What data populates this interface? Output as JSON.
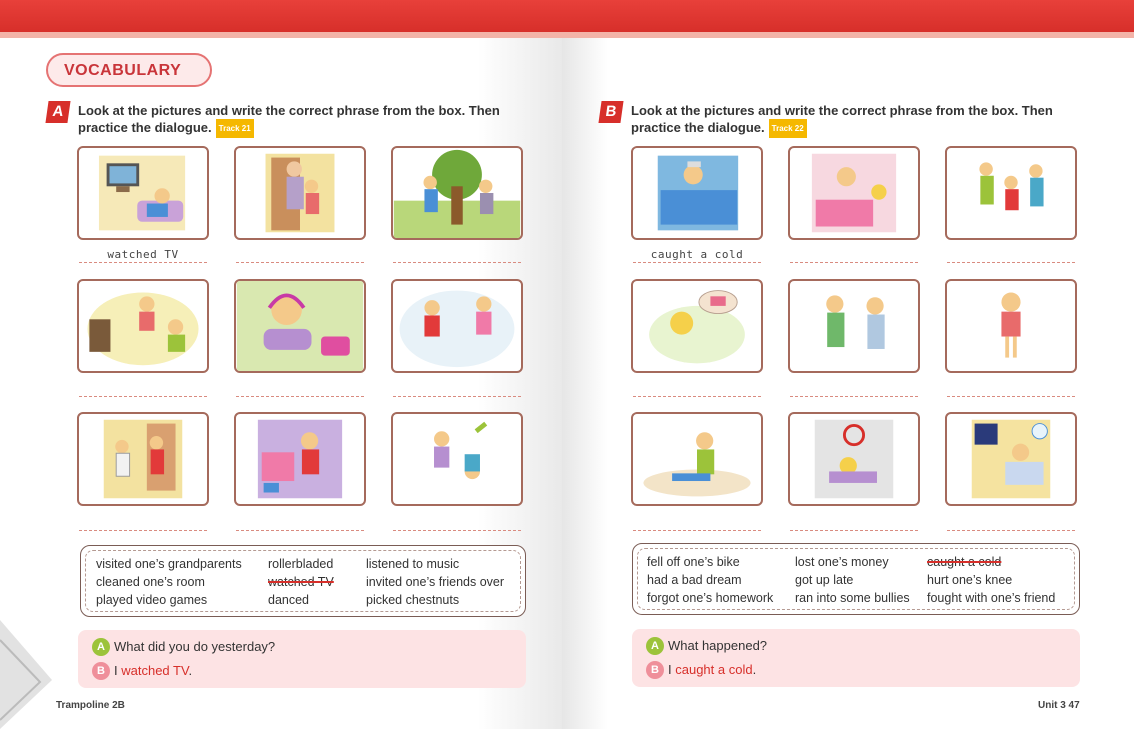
{
  "header": {
    "vocab_label": "VOCABULARY"
  },
  "section_a": {
    "letter": "A",
    "instruction_line1": "Look at the pictures and write the correct phrase from the box. Then",
    "instruction_line2": "practice the dialogue.",
    "track": "Track 21",
    "answers": [
      "watched TV",
      "",
      "",
      "",
      "",
      "",
      "",
      "",
      ""
    ],
    "word_box": [
      [
        "visited one’s grandparents",
        "rollerbladed",
        "listened to music"
      ],
      [
        "cleaned one’s room",
        "watched TV",
        "invited one’s friends over"
      ],
      [
        "played video games",
        "danced",
        "picked chestnuts"
      ]
    ],
    "dialogue": {
      "a_label": "A",
      "b_label": "B",
      "question": "What did you do yesterday?",
      "answer_prefix": "I ",
      "answer_text": "watched TV",
      "answer_suffix": "."
    }
  },
  "section_b": {
    "letter": "B",
    "instruction_line1": "Look at the pictures and write the correct phrase from the box. Then",
    "instruction_line2": "practice the dialogue.",
    "track": "Track 22",
    "answers": [
      "caught a cold",
      "",
      "",
      "",
      "",
      "",
      "",
      "",
      ""
    ],
    "word_box": [
      [
        "fell off one’s bike",
        "lost one’s money",
        "caught a cold"
      ],
      [
        "had a bad dream",
        "got up late",
        "hurt one’s knee"
      ],
      [
        "forgot one’s homework",
        "ran into some bullies",
        "fought with one’s friend"
      ]
    ],
    "dialogue": {
      "a_label": "A",
      "b_label": "B",
      "question": "What happened?",
      "answer_prefix": "I ",
      "answer_text": "caught a cold",
      "answer_suffix": "."
    }
  },
  "footer": {
    "left": "Trampoline 2B",
    "right": "Unit 3 47"
  },
  "colors": {
    "accent": "#d72f2a",
    "frame": "#a56a5c",
    "dialogue_bg": "#fde3e4",
    "bubble_a": "#9cc33a",
    "bubble_b": "#ef8f9a"
  }
}
